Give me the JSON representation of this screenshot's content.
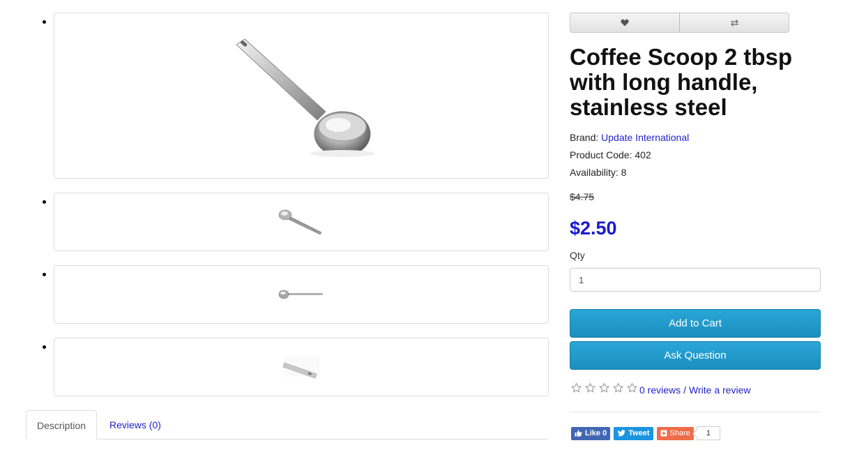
{
  "product": {
    "title": "Coffee Scoop 2 tbsp with long handle, stainless steel",
    "brand_label": "Brand:",
    "brand_name": "Update International",
    "code_label": "Product Code:",
    "code_value": "402",
    "availability_label": "Availability:",
    "availability_value": "8",
    "old_price": "$4.75",
    "price": "$2.50"
  },
  "actions": {
    "wishlist_icon": "heart-icon",
    "compare_icon": "compare-arrows-icon"
  },
  "purchase": {
    "qty_label": "Qty",
    "qty_value": "1",
    "add_to_cart": "Add to Cart",
    "ask_question": "Ask Question"
  },
  "rating": {
    "stars_filled": 0,
    "stars_total": 5,
    "reviews_link": "0 reviews",
    "separator": "/",
    "write_review": "Write a review"
  },
  "social": {
    "like_label": "Like 0",
    "tweet_label": "Tweet",
    "share_label": "Share",
    "share_count": "1"
  },
  "tabs": [
    {
      "label": "Description",
      "active": true
    },
    {
      "label": "Reviews (0)",
      "active": false
    }
  ],
  "colors": {
    "price": "#1a1acc",
    "link": "#2222cc",
    "button": "#1f98c8",
    "facebook": "#4267b2",
    "twitter": "#1b95e0",
    "share": "#ef6c4a"
  }
}
